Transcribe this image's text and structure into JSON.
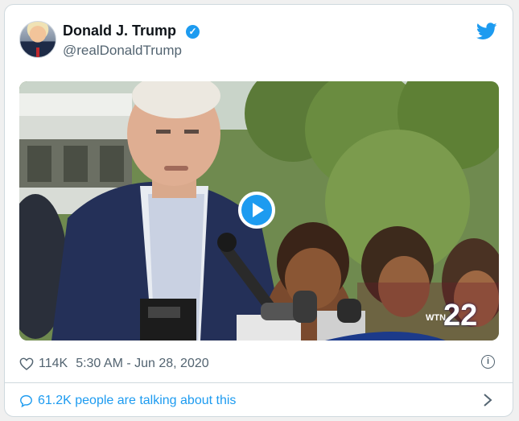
{
  "tweet": {
    "author_name": "Donald J. Trump",
    "handle": "@realDonaldTrump",
    "likes": "114K",
    "timestamp": "5:30 AM - Jun 28, 2020",
    "talking_text": "61.2K people are talking about this"
  },
  "video": {
    "channel_number": "22",
    "channel_prefix": "WTN"
  },
  "icons": {
    "verified": "verified-badge-icon",
    "brand": "twitter-bird-icon",
    "play": "play-icon",
    "like": "heart-icon",
    "info": "info-icon",
    "conversation": "speech-bubble-icon",
    "expand": "chevron-right-icon"
  },
  "colors": {
    "accent": "#1d9bf0",
    "text_primary": "#0f1419",
    "text_secondary": "#536471",
    "border": "#cfd9de"
  }
}
